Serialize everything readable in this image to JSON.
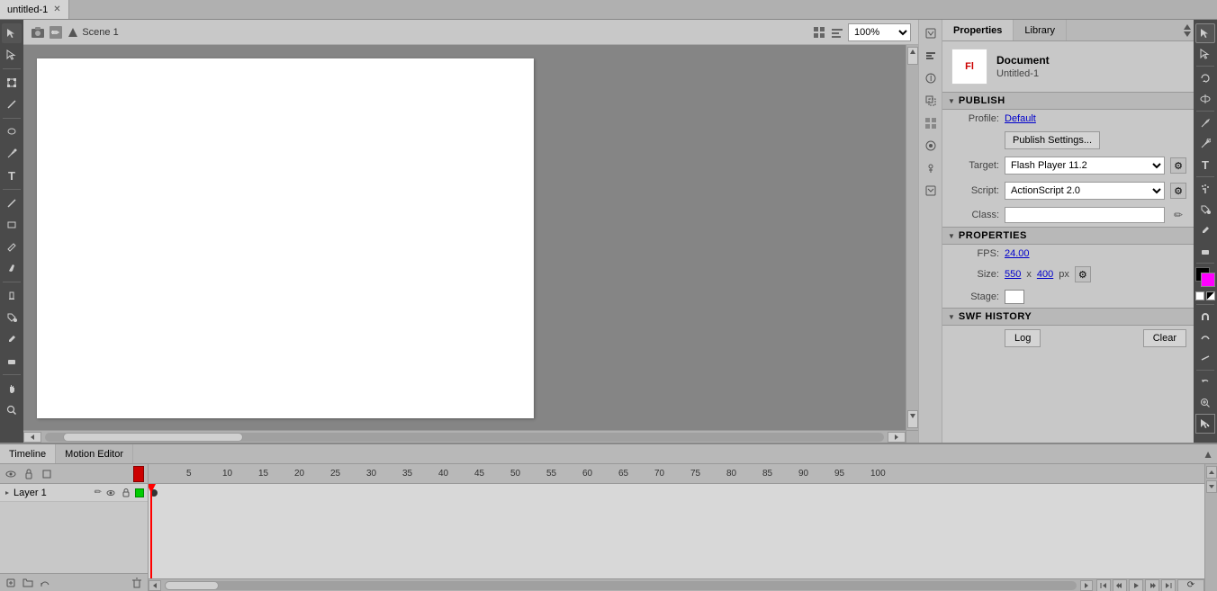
{
  "tabs": [
    {
      "label": "untitled-1",
      "active": true
    }
  ],
  "breadcrumb": {
    "scene_label": "Scene 1"
  },
  "toolbar_top": {
    "zoom_value": "100%"
  },
  "properties_panel": {
    "tabs": [
      "Properties",
      "Library"
    ],
    "active_tab": "Properties",
    "document_label": "Document",
    "file_name": "Untitled-1",
    "fl_icon": "Fl",
    "publish_section": "PUBLISH",
    "profile_label": "Profile:",
    "profile_value": "Default",
    "publish_settings_btn": "Publish Settings...",
    "target_label": "Target:",
    "target_value": "Flash Player 11.2",
    "script_label": "Script:",
    "script_value": "ActionScript 2.0",
    "class_label": "Class:",
    "class_value": "",
    "properties_section": "PROPERTIES",
    "fps_label": "FPS:",
    "fps_value": "24.00",
    "size_label": "Size:",
    "size_width": "550",
    "size_x": "x",
    "size_height": "400",
    "size_px": "px",
    "stage_label": "Stage:",
    "swf_history_section": "SWF HISTORY",
    "log_btn": "Log",
    "clear_btn": "Clear"
  },
  "timeline": {
    "tabs": [
      "imeline",
      "Motion Editor"
    ],
    "active_tab": "imeline",
    "layer_name": "Layer 1",
    "frame_numbers": [
      5,
      10,
      15,
      20,
      25,
      30,
      35,
      40,
      45,
      50,
      55,
      60,
      65,
      70,
      75,
      80,
      85,
      90,
      95,
      100
    ]
  },
  "right_tools": {
    "colors": {
      "stroke": "#000000",
      "fill": "#ff00ff"
    }
  }
}
